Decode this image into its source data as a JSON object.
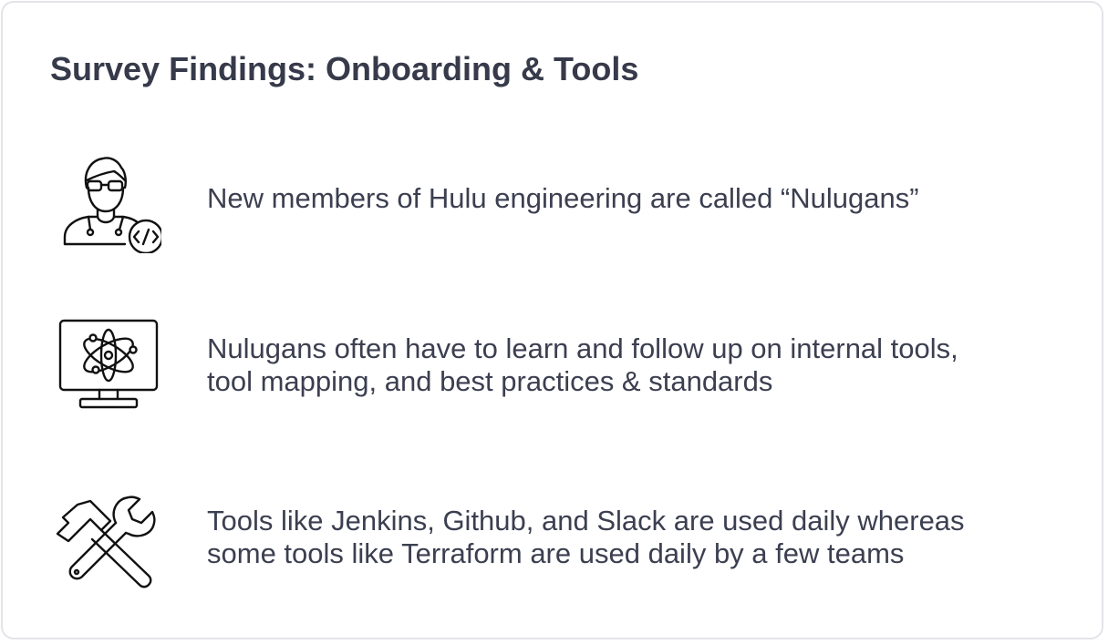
{
  "slide": {
    "title": "Survey Findings: Onboarding & Tools",
    "findings": [
      {
        "icon": "developer-icon",
        "lines": [
          "New members of Hulu engineering are called “Nulugans”"
        ]
      },
      {
        "icon": "monitor-atom-icon",
        "lines": [
          "Nulugans often have to learn and follow up on internal tools,",
          "tool mapping, and best practices & standards"
        ]
      },
      {
        "icon": "hammer-wrench-icon",
        "lines": [
          "Tools like Jenkins, Github, and Slack are used daily whereas",
          "some tools like Terraform are used daily by a few teams"
        ]
      }
    ]
  },
  "colors": {
    "text": "#3b3f50",
    "title": "#363a4a",
    "icon_stroke": "#111111",
    "border": "#e3e3e8"
  }
}
